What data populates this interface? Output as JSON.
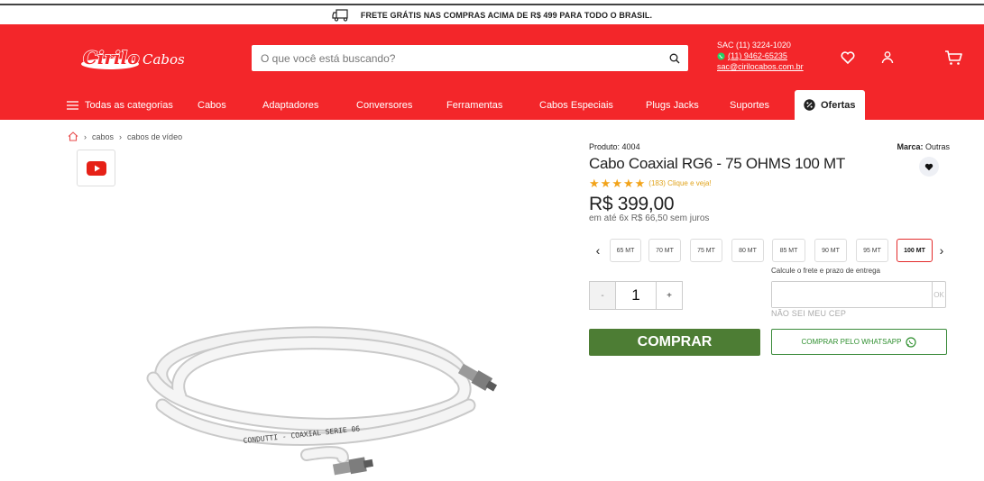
{
  "promo": {
    "text": "FRETE GRÁTIS NAS COMPRAS ACIMA DE R$ 499 PARA TODO O BRASIL."
  },
  "header": {
    "logo": "CiriloCabos",
    "search_placeholder": "O que você está buscando?",
    "sac_phone": "SAC (11) 3224-1020",
    "whatsapp": "(11) 9462-65235",
    "email": "sac@cirilocabos.com.br"
  },
  "nav": {
    "all_categories": "Todas as categorias",
    "items": [
      "Cabos",
      "Adaptadores",
      "Conversores",
      "Ferramentas",
      "Cabos Especiais",
      "Plugs Jacks",
      "Suportes"
    ],
    "ofertas": "Ofertas"
  },
  "breadcrumb": {
    "items": [
      "cabos",
      "cabos de vídeo"
    ]
  },
  "product": {
    "code_label": "Produto:",
    "code": "4004",
    "brand_label": "Marca:",
    "brand": "Outras",
    "name": "Cabo Coaxial RG6 - 75 OHMS 100 MT",
    "rating_text": "(183) Clique e veja!",
    "price": "R$ 399,00",
    "installments": "em até 6x R$ 66,50 sem juros",
    "sizes": [
      "65 MT",
      "70 MT",
      "75 MT",
      "80 MT",
      "85 MT",
      "90 MT",
      "95 MT",
      "100 MT"
    ],
    "selected_size": "100 MT",
    "quantity": "1",
    "freight_label": "Calcule o frete e prazo de entrega",
    "ok": "OK",
    "no_cep": "NÃO SEI MEU CEP",
    "buy": "COMPRAR",
    "buy_whatsapp": "COMPRAR PELO WHATSAPP"
  },
  "colors": {
    "brand_red": "#f3262a",
    "buy_green": "#4d7d34",
    "star": "#f2a319"
  }
}
